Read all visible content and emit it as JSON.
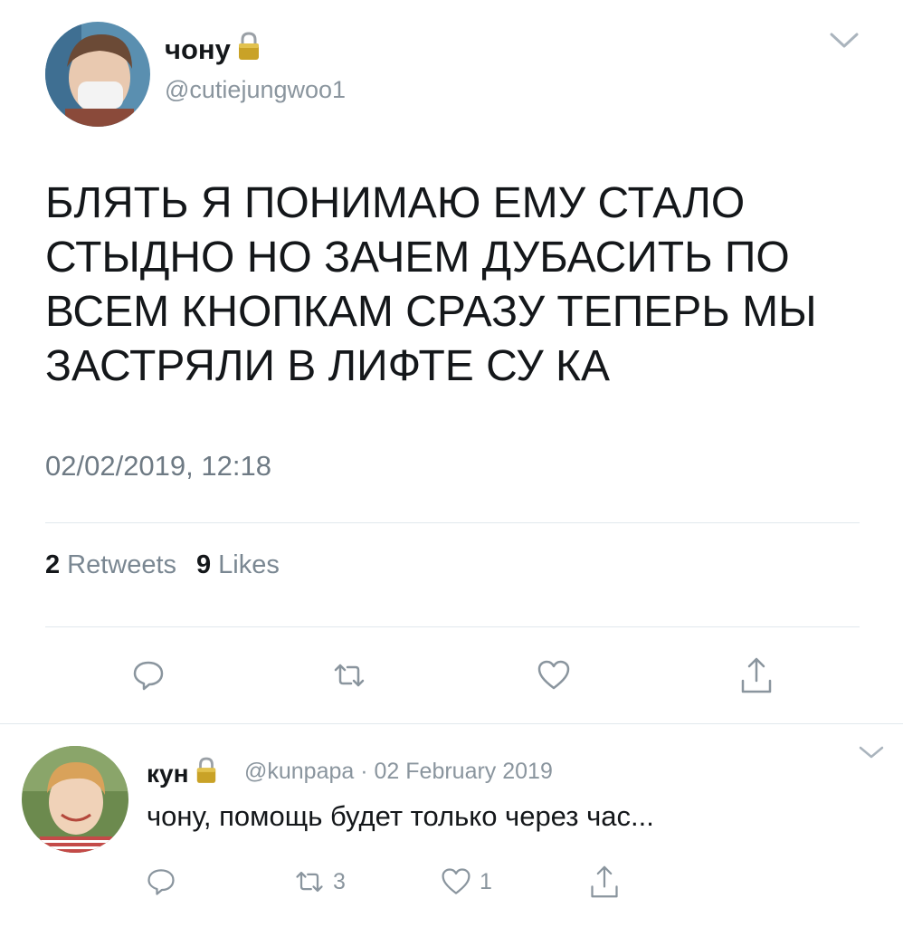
{
  "tweet": {
    "display_name": "чону",
    "handle": "@cutiejungwoo1",
    "text": "БЛЯТЬ Я ПОНИМАЮ ЕМУ СТАЛО СТЫДНО НО ЗАЧЕМ ДУБАСИТЬ ПО ВСЕМ КНОПКАМ СРАЗУ ТЕПЕРЬ МЫ ЗАСТРЯЛИ В ЛИФТЕ СУ КА",
    "timestamp": "02/02/2019, 12:18",
    "retweets_count": "2",
    "retweets_label": "Retweets",
    "likes_count": "9",
    "likes_label": "Likes"
  },
  "reply": {
    "display_name": "кун",
    "meta": "@kunpapa · 02 February 2019",
    "text": "чону, помощь будет только через час...",
    "retweets_count": "3",
    "likes_count": "1"
  },
  "icons": {
    "lock": "lock-icon",
    "chevron": "chevron-down-icon",
    "reply": "reply-icon",
    "retweet": "retweet-icon",
    "like": "heart-icon",
    "share": "share-icon"
  },
  "colors": {
    "text": "#14171a",
    "secondary": "#8a959e",
    "divider": "#e1e8ed",
    "lock_gold": "#c9a227"
  }
}
